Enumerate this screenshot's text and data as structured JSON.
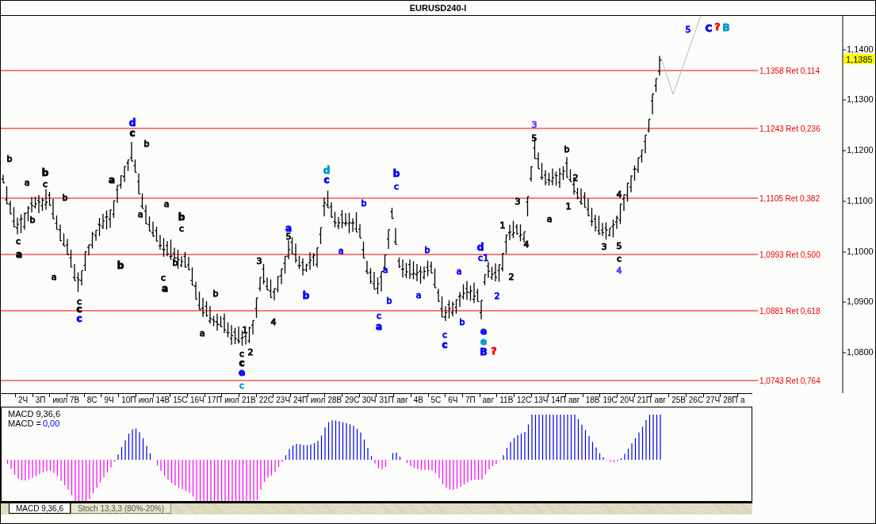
{
  "title": "EURUSD240-I",
  "price_axis": {
    "ticks": [
      "1,1400",
      "1,1300",
      "1,1200",
      "1,1100",
      "1,1000",
      "1,0900",
      "1,0800"
    ],
    "current_price": "1,1385"
  },
  "retracement_levels": [
    {
      "label": "1,1358 Ret 0,114"
    },
    {
      "label": "1,1243 Ret 0,236"
    },
    {
      "label": "1,1105 Ret 0,382"
    },
    {
      "label": "1,0993 Ret 0,500"
    },
    {
      "label": "1,0881 Ret 0,618"
    },
    {
      "label": "1,0743 Ret 0,764"
    }
  ],
  "wave_labels": [
    {
      "text": "b",
      "color": "#000000",
      "bold": false
    },
    {
      "text": "c",
      "color": "#000000",
      "bold": false
    },
    {
      "text": "a",
      "color": "#000000",
      "bold": true
    },
    {
      "text": "a",
      "color": "#000000",
      "bold": false
    },
    {
      "text": "b",
      "color": "#000000",
      "bold": false
    },
    {
      "text": "b",
      "color": "#000000",
      "bold": true
    },
    {
      "text": "c",
      "color": "#000000",
      "bold": false
    },
    {
      "text": "a",
      "color": "#000000",
      "bold": false
    },
    {
      "text": "b",
      "color": "#000000",
      "bold": false
    },
    {
      "text": "c",
      "color": "#000000",
      "bold": false
    },
    {
      "text": "c",
      "color": "#000000",
      "bold": true
    },
    {
      "text": "c",
      "color": "#0000ff",
      "bold": true
    },
    {
      "text": "a",
      "color": "#000000",
      "bold": true
    },
    {
      "text": "b",
      "color": "#000000",
      "bold": true
    },
    {
      "text": "d",
      "color": "#0000ff",
      "bold": true
    },
    {
      "text": "c",
      "color": "#000000",
      "bold": true
    },
    {
      "text": "a",
      "color": "#000000",
      "bold": false
    },
    {
      "text": "b",
      "color": "#000000",
      "bold": false
    },
    {
      "text": "a",
      "color": "#000000",
      "bold": false
    },
    {
      "text": "c",
      "color": "#000000",
      "bold": false
    },
    {
      "text": "a",
      "color": "#000000",
      "bold": true
    },
    {
      "text": "b",
      "color": "#000000",
      "bold": false
    },
    {
      "text": "b",
      "color": "#000000",
      "bold": true
    },
    {
      "text": "c",
      "color": "#000000",
      "bold": false
    },
    {
      "text": "a",
      "color": "#000000",
      "bold": false
    },
    {
      "text": "b",
      "color": "#000000",
      "bold": false
    },
    {
      "text": "1",
      "color": "#000000",
      "bold": false
    },
    {
      "text": "c",
      "color": "#000000",
      "bold": false
    },
    {
      "text": "c",
      "color": "#000000",
      "bold": true
    },
    {
      "text": "e",
      "color": "#0000ff",
      "bold": true
    },
    {
      "text": "c",
      "color": "#0099cc",
      "bold": false
    },
    {
      "text": "2",
      "color": "#000000",
      "bold": false
    },
    {
      "text": "3",
      "color": "#000000",
      "bold": false
    },
    {
      "text": "4",
      "color": "#000000",
      "bold": false
    },
    {
      "text": "a",
      "color": "#0000ff",
      "bold": true
    },
    {
      "text": "5",
      "color": "#000000",
      "bold": false
    },
    {
      "text": "b",
      "color": "#0000ff",
      "bold": true
    },
    {
      "text": "d",
      "color": "#0099cc",
      "bold": true
    },
    {
      "text": "c",
      "color": "#0000ff",
      "bold": true
    },
    {
      "text": "a",
      "color": "#0000ff",
      "bold": false
    },
    {
      "text": "b",
      "color": "#0000ff",
      "bold": false
    },
    {
      "text": "a",
      "color": "#0000ff",
      "bold": false
    },
    {
      "text": "c",
      "color": "#0000ff",
      "bold": false
    },
    {
      "text": "a",
      "color": "#0000ff",
      "bold": true
    },
    {
      "text": "b",
      "color": "#0000ff",
      "bold": false
    },
    {
      "text": "b",
      "color": "#0000ff",
      "bold": true
    },
    {
      "text": "c",
      "color": "#0000ff",
      "bold": false
    },
    {
      "text": "a",
      "color": "#0000ff",
      "bold": false
    },
    {
      "text": "b",
      "color": "#0000ff",
      "bold": false
    },
    {
      "text": "c",
      "color": "#0000ff",
      "bold": false
    },
    {
      "text": "c",
      "color": "#0000ff",
      "bold": true
    },
    {
      "text": "a",
      "color": "#0000ff",
      "bold": false
    },
    {
      "text": "b",
      "color": "#0000ff",
      "bold": false
    },
    {
      "text": "d",
      "color": "#0000ff",
      "bold": true
    },
    {
      "text": "c",
      "color": "#0000ff",
      "bold": false
    },
    {
      "text": "1",
      "color": "#0000ff",
      "bold": false
    },
    {
      "text": "e",
      "color": "#0000ff",
      "bold": true
    },
    {
      "text": "e",
      "color": "#0099cc",
      "bold": true
    },
    {
      "text": "B",
      "color": "#0000ff",
      "bold": true
    },
    {
      "text": "2",
      "color": "#0000ff",
      "bold": false
    },
    {
      "text": "?",
      "color": "#ff0000",
      "bold": true
    },
    {
      "text": "1",
      "color": "#000000",
      "bold": false
    },
    {
      "text": "2",
      "color": "#000000",
      "bold": false
    },
    {
      "text": "3",
      "color": "#000000",
      "bold": false
    },
    {
      "text": "4",
      "color": "#000000",
      "bold": false
    },
    {
      "text": "3",
      "color": "#6633ff",
      "bold": false
    },
    {
      "text": "5",
      "color": "#000000",
      "bold": false
    },
    {
      "text": "a",
      "color": "#000000",
      "bold": false
    },
    {
      "text": "b",
      "color": "#000000",
      "bold": false
    },
    {
      "text": "1",
      "color": "#000000",
      "bold": false
    },
    {
      "text": "2",
      "color": "#000000",
      "bold": false
    },
    {
      "text": "3",
      "color": "#000000",
      "bold": false
    },
    {
      "text": "4",
      "color": "#000000",
      "bold": false
    },
    {
      "text": "5",
      "color": "#000000",
      "bold": false
    },
    {
      "text": "c",
      "color": "#000000",
      "bold": false
    },
    {
      "text": "4",
      "color": "#6633ff",
      "bold": false
    },
    {
      "text": "5",
      "color": "#0000ff",
      "bold": false
    },
    {
      "text": "C",
      "color": "#0000ff",
      "bold": true
    },
    {
      "text": "?",
      "color": "#ff0000",
      "bold": true
    },
    {
      "text": "B",
      "color": "#0099cc",
      "bold": true
    }
  ],
  "time_axis": [
    "2Ч",
    "3П",
    "июл",
    "7В",
    "8С",
    "9Ч",
    "10П",
    "июл",
    "14В",
    "15С",
    "16Ч",
    "17П",
    "июл",
    "21В",
    "22С",
    "23Ч",
    "24П",
    "июл",
    "28В",
    "29С",
    "30Ч",
    "31П",
    "авг",
    "4В",
    "5С",
    "6Ч",
    "7П",
    "авг",
    "11В",
    "12С",
    "13Ч",
    "14П",
    "авг",
    "18В",
    "19С",
    "20Ч",
    "21П",
    "авг",
    "25В",
    "26С",
    "27Ч",
    "28П",
    "а"
  ],
  "indicator": {
    "name": "MACD 9,36,6",
    "value_label": "MACD =",
    "value": "0,00"
  },
  "indicator_tabs": [
    {
      "label": "MACD 9,36,6",
      "selected": true
    },
    {
      "label": "Stoch 13,3,3 (80%-20%)",
      "selected": false
    }
  ]
}
